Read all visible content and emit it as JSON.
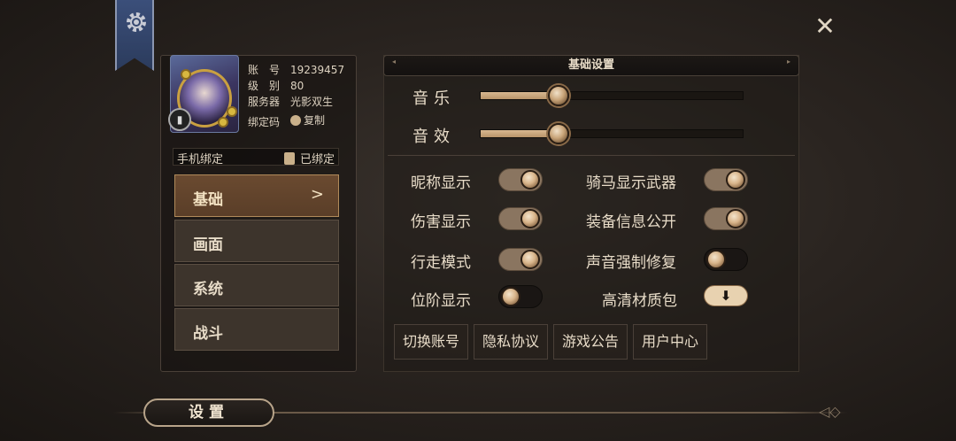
{
  "profile": {
    "account_label": "账　号",
    "account_value": "19239457",
    "level_label": "级　别",
    "level_value": "80",
    "server_label": "服务器",
    "server_value": "光影双生",
    "bind_code_label": "绑定码",
    "copy_label": "复制"
  },
  "phone_bind": {
    "label": "手机绑定",
    "status": "已绑定"
  },
  "tabs": [
    {
      "label": "基础",
      "arrow": ">"
    },
    {
      "label": "画面"
    },
    {
      "label": "系统"
    },
    {
      "label": "战斗"
    }
  ],
  "panel": {
    "title": "基础设置"
  },
  "sliders": [
    {
      "label": "音乐",
      "value_fraction": 0.3
    },
    {
      "label": "音效",
      "value_fraction": 0.3
    }
  ],
  "toggles_left": [
    {
      "label": "昵称显示",
      "on": true
    },
    {
      "label": "伤害显示",
      "on": true
    },
    {
      "label": "行走模式",
      "on": true
    },
    {
      "label": "位阶显示",
      "on": false
    }
  ],
  "toggles_right": [
    {
      "label": "骑马显示武器",
      "on": true
    },
    {
      "label": "装备信息公开",
      "on": true
    },
    {
      "label": "声音强制修复",
      "on": false
    },
    {
      "label": "高清材质包",
      "button_icon": "download-arrow-icon"
    }
  ],
  "bottom_buttons": [
    {
      "label": "切换账号"
    },
    {
      "label": "隐私协议"
    },
    {
      "label": "游戏公告"
    },
    {
      "label": "用户中心"
    }
  ],
  "footer": {
    "title": "设置"
  },
  "colors": {
    "accent": "#b8946a",
    "banner": "#3b4f7a",
    "active_tab": "#6a4a30"
  }
}
